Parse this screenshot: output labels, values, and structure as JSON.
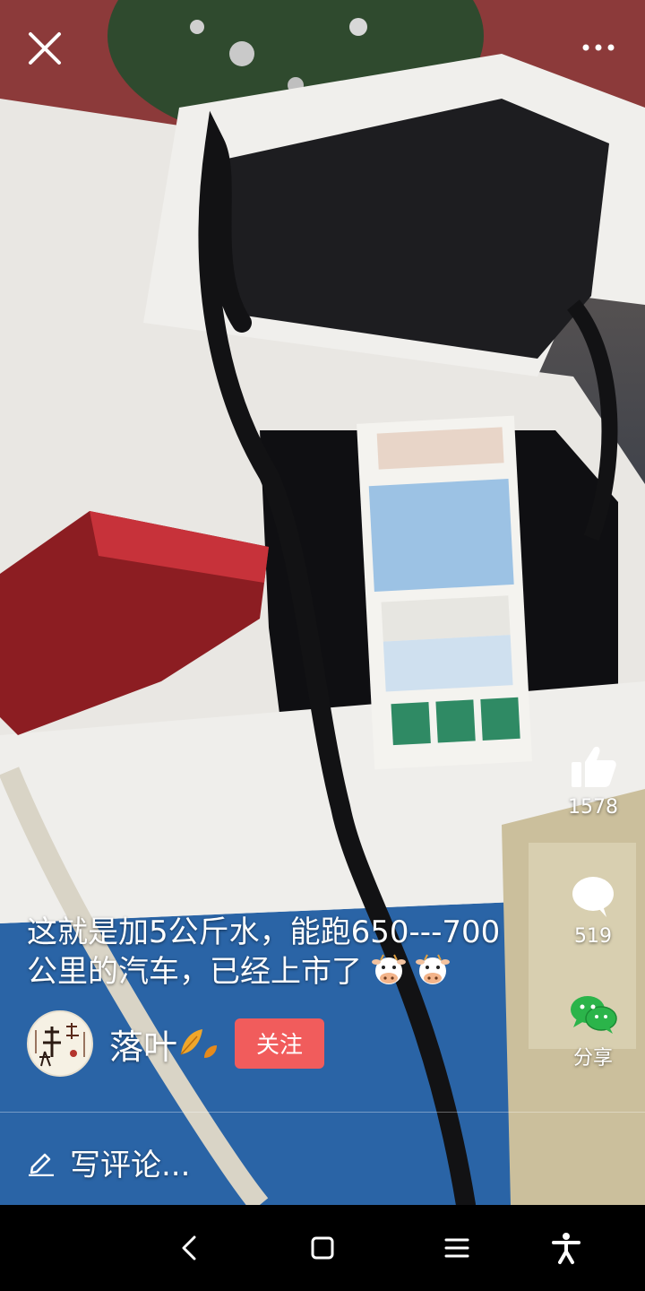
{
  "video": {
    "description_icon": "video-frame"
  },
  "top_bar": {
    "close_icon": "close-icon",
    "more_icon": "more-icon"
  },
  "actions": {
    "like": {
      "icon": "thumbs-up-icon",
      "count": "1578"
    },
    "comment": {
      "icon": "speech-bubble-icon",
      "count": "519"
    },
    "share": {
      "icon": "wechat-icon",
      "label": "分享"
    }
  },
  "caption": {
    "line1": "这就是加5公斤水，能跑650---700",
    "line2": "公里的汽车，已经上市了"
  },
  "author": {
    "name": "落叶",
    "follow_label": "关注"
  },
  "comment_input": {
    "placeholder": "写评论..."
  },
  "navbar": {
    "back_icon": "back-icon",
    "home_icon": "home-icon",
    "menu_icon": "menu-icon",
    "accessibility_icon": "accessibility-icon"
  },
  "colors": {
    "follow_button": "#f15c5c",
    "wechat_green": "#2bb44a"
  }
}
